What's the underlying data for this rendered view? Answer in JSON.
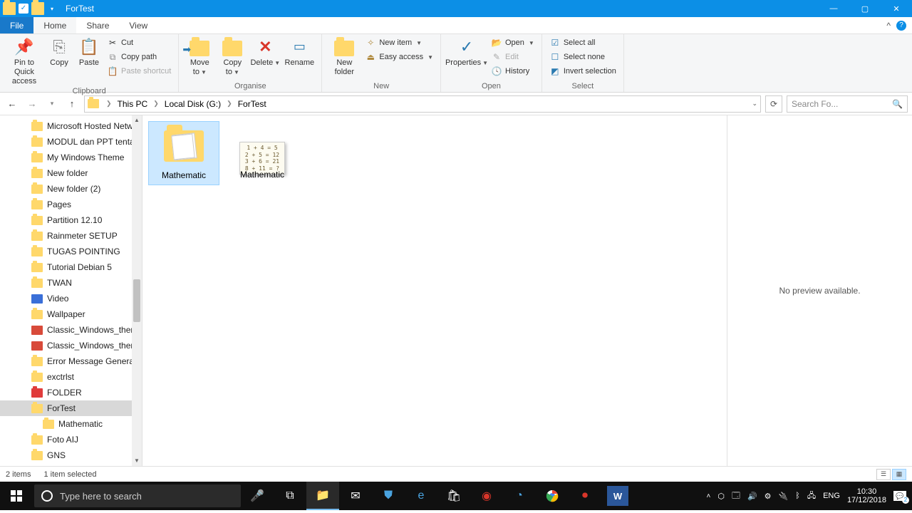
{
  "window": {
    "title": "ForTest"
  },
  "tabs": {
    "file": "File",
    "home": "Home",
    "share": "Share",
    "view": "View"
  },
  "ribbon": {
    "clipboard": {
      "label": "Clipboard",
      "pin": "Pin to Quick access",
      "copy": "Copy",
      "paste": "Paste",
      "cut": "Cut",
      "copypath": "Copy path",
      "pasteshortcut": "Paste shortcut"
    },
    "organise": {
      "label": "Organise",
      "moveto": "Move to",
      "copyto": "Copy to",
      "delete": "Delete",
      "rename": "Rename"
    },
    "new": {
      "label": "New",
      "newfolder": "New folder",
      "newitem": "New item",
      "easyaccess": "Easy access"
    },
    "open": {
      "label": "Open",
      "properties": "Properties",
      "open": "Open",
      "edit": "Edit",
      "history": "History"
    },
    "select": {
      "label": "Select",
      "selectall": "Select all",
      "selectnone": "Select none",
      "invert": "Invert selection"
    }
  },
  "breadcrumb": [
    "This PC",
    "Local Disk (G:)",
    "ForTest"
  ],
  "search_placeholder": "Search Fo...",
  "tree": [
    {
      "label": "Microsoft Hosted Netwo",
      "type": "folder"
    },
    {
      "label": "MODUL dan PPT tentang",
      "type": "folder"
    },
    {
      "label": "My Windows Theme",
      "type": "folder"
    },
    {
      "label": "New folder",
      "type": "folder"
    },
    {
      "label": "New folder (2)",
      "type": "folder"
    },
    {
      "label": "Pages",
      "type": "folder"
    },
    {
      "label": "Partition 12.10",
      "type": "folder"
    },
    {
      "label": "Rainmeter SETUP",
      "type": "folder"
    },
    {
      "label": "TUGAS POINTING",
      "type": "folder"
    },
    {
      "label": "Tutorial Debian 5",
      "type": "folder"
    },
    {
      "label": "TWAN",
      "type": "folder"
    },
    {
      "label": "Video",
      "type": "video"
    },
    {
      "label": "Wallpaper",
      "type": "folder"
    },
    {
      "label": "Classic_Windows_themes",
      "type": "theme"
    },
    {
      "label": "Classic_Windows_themes",
      "type": "theme"
    },
    {
      "label": "Error Message Generator",
      "type": "folder"
    },
    {
      "label": "exctrlst",
      "type": "folder"
    },
    {
      "label": "FOLDER",
      "type": "red"
    },
    {
      "label": "ForTest",
      "type": "folder",
      "selected": true
    },
    {
      "label": "Mathematic",
      "type": "folder",
      "indent": true
    },
    {
      "label": "Foto AIJ",
      "type": "folder"
    },
    {
      "label": "GNS",
      "type": "folder"
    }
  ],
  "files": [
    {
      "name": "Mathematic",
      "kind": "folder",
      "selected": true
    },
    {
      "name": "Mathematic",
      "kind": "image"
    }
  ],
  "math_lines": [
    "1 + 4 = 5",
    "2 + 5 = 12",
    "3 + 6 = 21",
    "8 + 11 = ?"
  ],
  "preview": "No preview available.",
  "status": {
    "count": "2 items",
    "selected": "1 item selected"
  },
  "taskbar": {
    "search": "Type here to search",
    "lang": "ENG",
    "time": "10:30",
    "date": "17/12/2018"
  }
}
